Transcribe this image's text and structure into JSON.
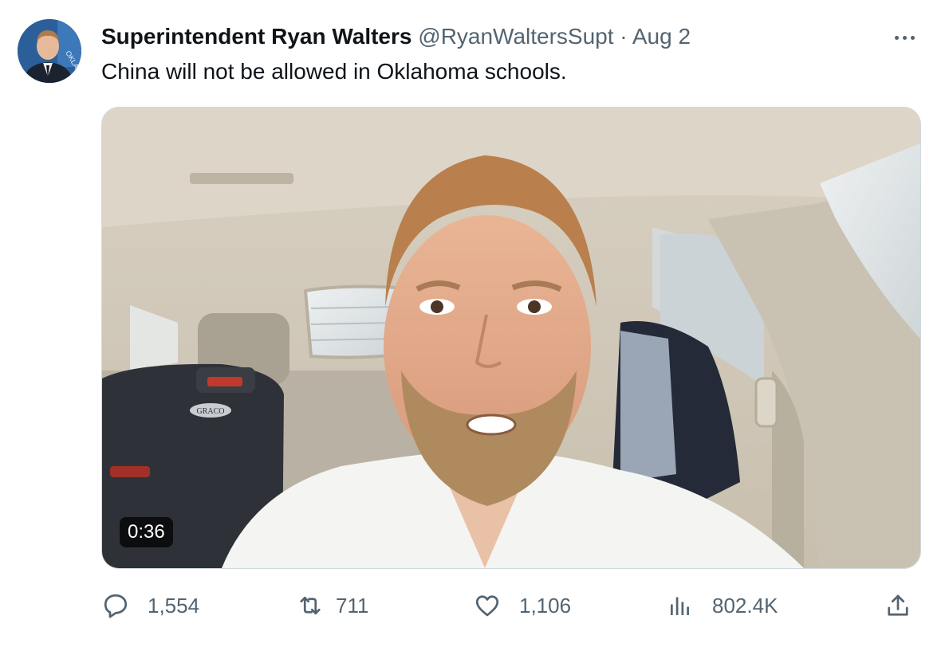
{
  "tweet": {
    "author_name": "Superintendent Ryan Walters",
    "handle": "@RyanWaltersSupt",
    "separator": "·",
    "date": "Aug 2",
    "text": "China will not be allowed in Oklahoma schools.",
    "avatar_flag_text": "OKLA"
  },
  "media": {
    "duration": "0:36",
    "car_seat_brand": "GRACO"
  },
  "actions": {
    "replies": "1,554",
    "retweets": "711",
    "likes": "1,106",
    "views": "802.4K"
  },
  "icons": {
    "more": "more-dots-icon",
    "reply": "reply-icon",
    "retweet": "retweet-icon",
    "like": "heart-icon",
    "views": "analytics-icon",
    "share": "share-icon"
  },
  "colors": {
    "text_primary": "#0f1419",
    "text_secondary": "#536471",
    "border": "#cfd9de"
  }
}
